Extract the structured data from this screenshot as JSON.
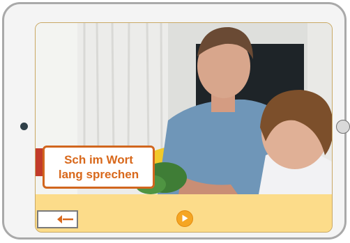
{
  "caption": {
    "line1": "Sch im Wort",
    "line2": "lang sprechen"
  },
  "icons": {
    "back": "arrow-left-icon",
    "play": "play-icon"
  },
  "colors": {
    "accent": "#d8681b",
    "control_bar": "#fcdc8a",
    "play": "#f5a623"
  }
}
